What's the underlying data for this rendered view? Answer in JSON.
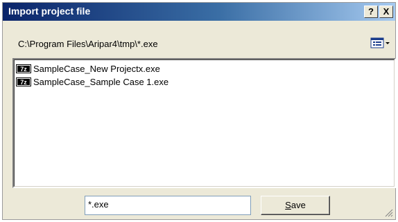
{
  "window": {
    "title": "Import project file",
    "help_label": "?",
    "close_label": "X"
  },
  "path": {
    "text": "C:\\Program Files\\Aripar4\\tmp\\*.exe"
  },
  "view_menu": {
    "icon": "view-list-icon"
  },
  "files": [
    {
      "icon": "7z-icon",
      "name": "SampleCase_New Projectx.exe"
    },
    {
      "icon": "7z-icon",
      "name": "SampleCase_Sample Case 1.exe"
    }
  ],
  "filename_field": {
    "value": "*.exe"
  },
  "save_button": {
    "mnemonic": "S",
    "rest": "ave"
  }
}
